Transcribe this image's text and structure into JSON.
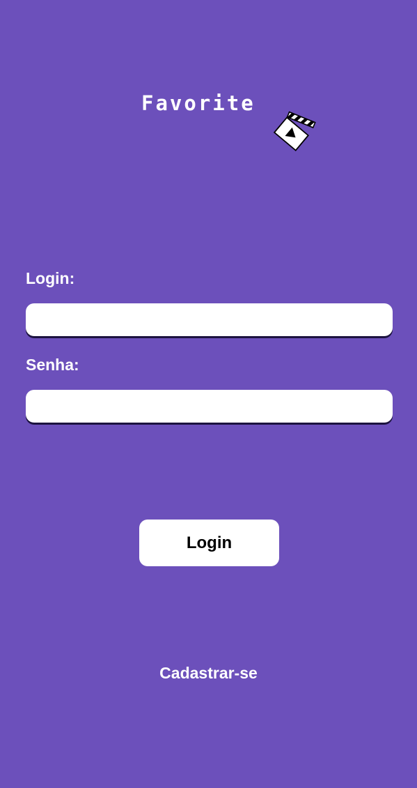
{
  "logo": {
    "title": "Favorite",
    "icon": "clapperboard-icon"
  },
  "form": {
    "login_label": "Login:",
    "login_value": "",
    "password_label": "Senha:",
    "password_value": ""
  },
  "actions": {
    "login_button": "Login",
    "register_link": "Cadastrar-se"
  },
  "colors": {
    "background": "#6C50BB",
    "text": "#FFFFFF",
    "button_background": "#FFFFFF",
    "button_text": "#000000"
  }
}
